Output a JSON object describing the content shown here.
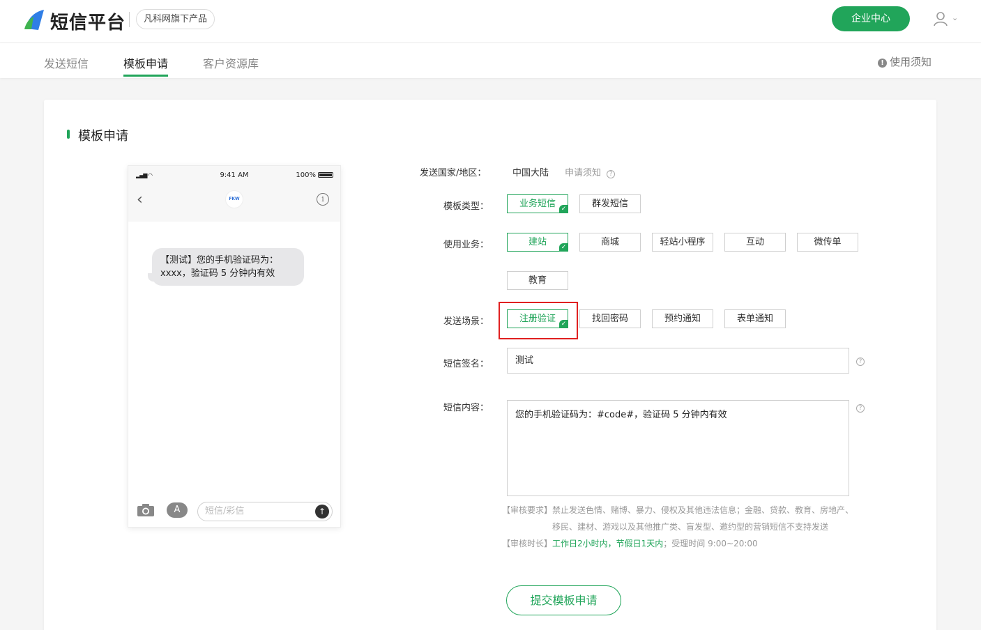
{
  "header": {
    "logo_text": "短信平台",
    "badge": "凡科网旗下产品",
    "enterprise_button": "企业中心"
  },
  "tabs": [
    {
      "label": "发送短信",
      "active": false
    },
    {
      "label": "模板申请",
      "active": true
    },
    {
      "label": "客户资源库",
      "active": false
    }
  ],
  "notice": "使用须知",
  "card_title": "模板申请",
  "phone": {
    "time": "9:41 AM",
    "battery": "100%",
    "avatar_text": "FKW",
    "message": "【测试】您的手机验证码为：xxxx，验证码 5 分钟内有效",
    "input_placeholder": "短信/彩信"
  },
  "form": {
    "country_label": "发送国家/地区：",
    "country_value": "中国大陆",
    "apply_notice": "申请须知",
    "type_label": "模板类型：",
    "types": [
      {
        "label": "业务短信",
        "selected": true
      },
      {
        "label": "群发短信",
        "selected": false
      }
    ],
    "business_label": "使用业务：",
    "businesses": [
      {
        "label": "建站",
        "selected": true
      },
      {
        "label": "商城",
        "selected": false
      },
      {
        "label": "轻站小程序",
        "selected": false
      },
      {
        "label": "互动",
        "selected": false
      },
      {
        "label": "微传单",
        "selected": false
      },
      {
        "label": "教育",
        "selected": false
      }
    ],
    "scene_label": "发送场景：",
    "scenes": [
      {
        "label": "注册验证",
        "selected": true
      },
      {
        "label": "找回密码",
        "selected": false
      },
      {
        "label": "预约通知",
        "selected": false
      },
      {
        "label": "表单通知",
        "selected": false
      }
    ],
    "signature_label": "短信签名：",
    "signature_value": "测试",
    "content_label": "短信内容：",
    "content_value": "您的手机验证码为：#code#，验证码 5 分钟内有效",
    "review_req_tag": "【审核要求】",
    "review_req_line1": "禁止发送色情、赌博、暴力、侵权及其他违法信息；金融、贷款、教育、房地产、",
    "review_req_line2": "移民、建材、游戏以及其他推广类、盲发型、邀约型的营销短信不支持发送",
    "review_time_tag": "【审核时长】",
    "review_time_green": "工作日2小时内，节假日1天内",
    "review_time_rest": "；受理时间 9:00~20:00",
    "submit": "提交模板申请"
  },
  "colors": {
    "accent": "#21a55a",
    "highlight_box": "#e02020"
  }
}
